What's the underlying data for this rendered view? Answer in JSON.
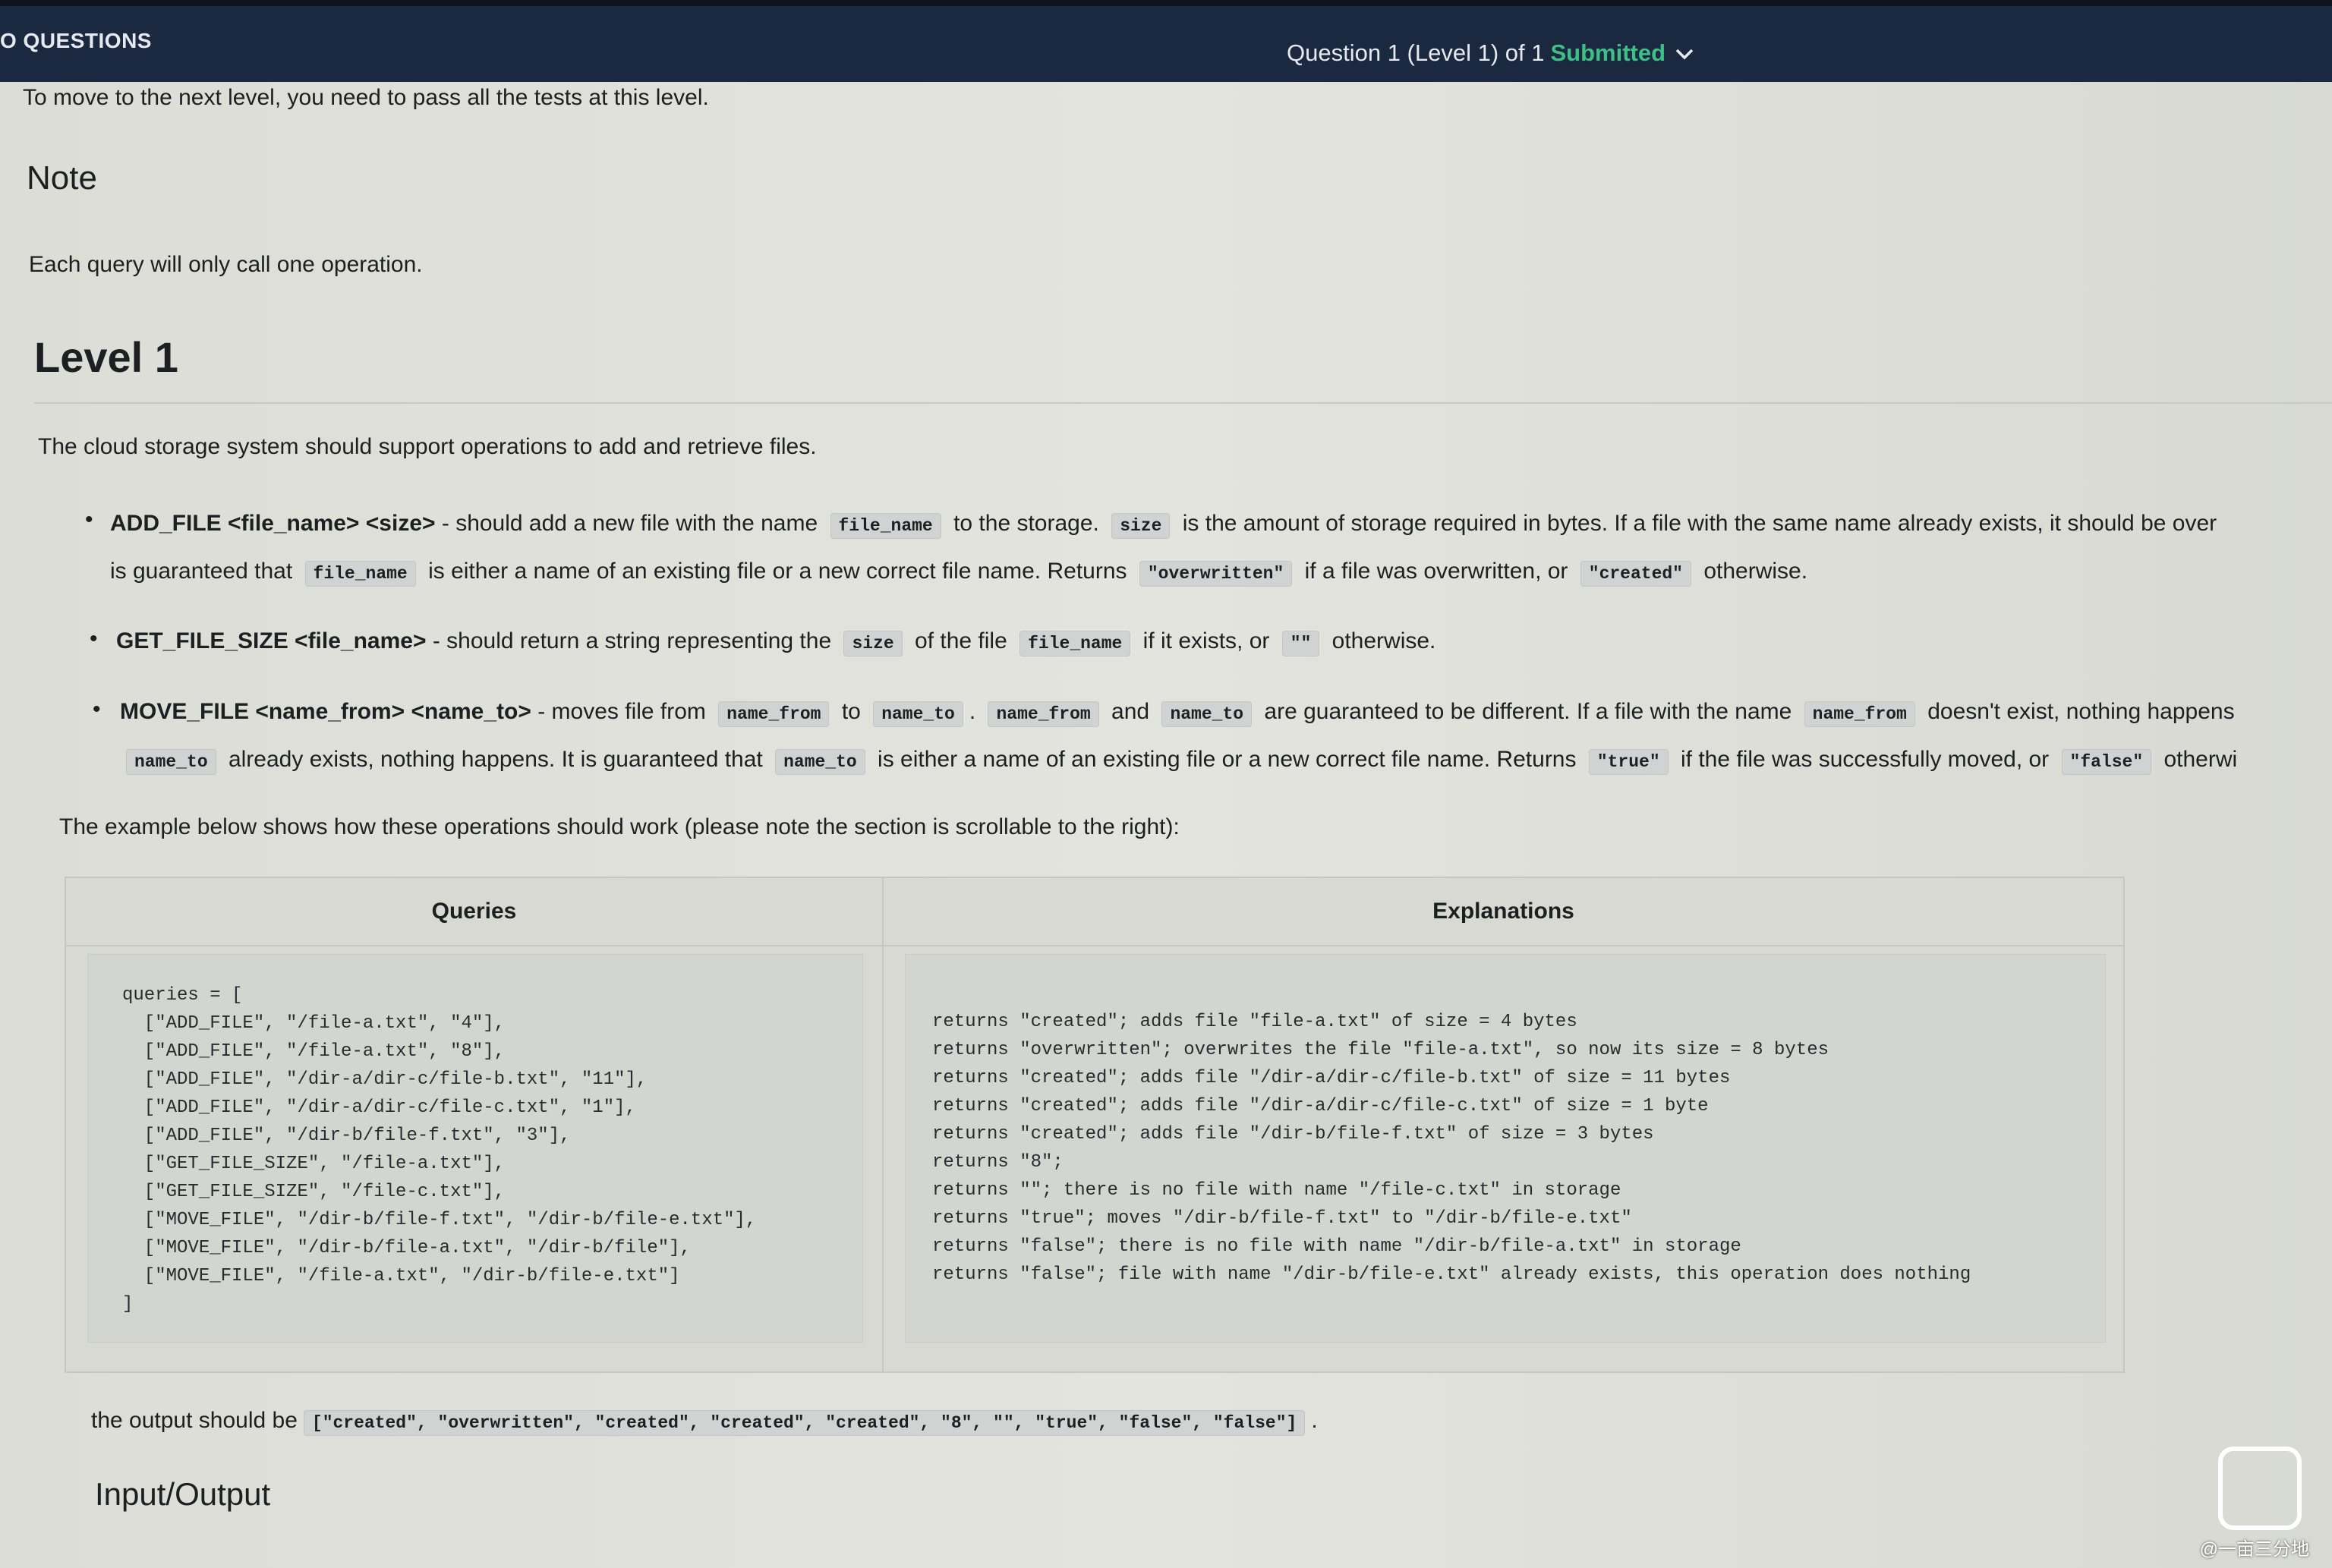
{
  "header": {
    "back_label": "O QUESTIONS",
    "question_title": "Question 1 (Level 1) of 1",
    "status": "Submitted",
    "status_color": "#3fbf85",
    "chevron_icon": "chevron-down-icon"
  },
  "intro": "To move to the next level, you need to pass all the tests at this level.",
  "note": {
    "heading": "Note",
    "text": "Each query will only call one operation."
  },
  "level": {
    "heading": "Level 1",
    "description": "The cloud storage system should support operations to add and retrieve files.",
    "bullets": [
      [
        [
          {
            "b": "ADD_FILE <file_name> <size>"
          },
          {
            "t": " - should add a new file with the name "
          },
          {
            "c": "file_name"
          },
          {
            "t": " to the storage. "
          },
          {
            "c": "size"
          },
          {
            "t": " is the amount of storage required in bytes. If a file with the same name already exists, it should be over"
          }
        ],
        [
          {
            "t": "is guaranteed that "
          },
          {
            "c": "file_name"
          },
          {
            "t": " is either a name of an existing file or a new correct file name. Returns "
          },
          {
            "c": "\"overwritten\""
          },
          {
            "t": " if a file was overwritten, or "
          },
          {
            "c": "\"created\""
          },
          {
            "t": " otherwise."
          }
        ]
      ],
      [
        [
          {
            "b": "GET_FILE_SIZE <file_name>"
          },
          {
            "t": " - should return a string representing the "
          },
          {
            "c": "size"
          },
          {
            "t": " of the file "
          },
          {
            "c": "file_name"
          },
          {
            "t": " if it exists, or "
          },
          {
            "c": "\"\""
          },
          {
            "t": " otherwise."
          }
        ]
      ],
      [
        [
          {
            "b": "MOVE_FILE <name_from> <name_to>"
          },
          {
            "t": " - moves file from "
          },
          {
            "c": "name_from"
          },
          {
            "t": " to "
          },
          {
            "c": "name_to"
          },
          {
            "t": ". "
          },
          {
            "c": "name_from"
          },
          {
            "t": " and "
          },
          {
            "c": "name_to"
          },
          {
            "t": " are guaranteed to be different. If a file with the name "
          },
          {
            "c": "name_from"
          },
          {
            "t": " doesn't exist, nothing happens"
          }
        ],
        [
          {
            "c": "name_to"
          },
          {
            "t": " already exists, nothing happens. It is guaranteed that "
          },
          {
            "c": "name_to"
          },
          {
            "t": " is either a name of an existing file or a new correct file name. Returns "
          },
          {
            "c": "\"true\""
          },
          {
            "t": " if the file was successfully moved, or "
          },
          {
            "c": "\"false\""
          },
          {
            "t": " otherwi"
          }
        ]
      ]
    ],
    "example_intro": "The example below shows how these operations should work (please note the section is scrollable to the right):"
  },
  "example_table": {
    "headers": [
      "Queries",
      "Explanations"
    ],
    "queries": "queries = [\n  [\"ADD_FILE\", \"/file-a.txt\", \"4\"],\n  [\"ADD_FILE\", \"/file-a.txt\", \"8\"],\n  [\"ADD_FILE\", \"/dir-a/dir-c/file-b.txt\", \"11\"],\n  [\"ADD_FILE\", \"/dir-a/dir-c/file-c.txt\", \"1\"],\n  [\"ADD_FILE\", \"/dir-b/file-f.txt\", \"3\"],\n  [\"GET_FILE_SIZE\", \"/file-a.txt\"],\n  [\"GET_FILE_SIZE\", \"/file-c.txt\"],\n  [\"MOVE_FILE\", \"/dir-b/file-f.txt\", \"/dir-b/file-e.txt\"],\n  [\"MOVE_FILE\", \"/dir-b/file-a.txt\", \"/dir-b/file\"],\n  [\"MOVE_FILE\", \"/file-a.txt\", \"/dir-b/file-e.txt\"]\n]",
    "explanations": "returns \"created\"; adds file \"file-a.txt\" of size = 4 bytes\nreturns \"overwritten\"; overwrites the file \"file-a.txt\", so now its size = 8 bytes\nreturns \"created\"; adds file \"/dir-a/dir-c/file-b.txt\" of size = 11 bytes\nreturns \"created\"; adds file \"/dir-a/dir-c/file-c.txt\" of size = 1 byte\nreturns \"created\"; adds file \"/dir-b/file-f.txt\" of size = 3 bytes\nreturns \"8\";\nreturns \"\"; there is no file with name \"/file-c.txt\" in storage\nreturns \"true\"; moves \"/dir-b/file-f.txt\" to \"/dir-b/file-e.txt\"\nreturns \"false\"; there is no file with name \"/dir-b/file-a.txt\" in storage\nreturns \"false\"; file with name \"/dir-b/file-e.txt\" already exists, this operation does nothing"
  },
  "output": {
    "label": "the output should be",
    "value": "[\"created\", \"overwritten\", \"created\", \"created\", \"created\", \"8\", \"\", \"true\", \"false\", \"false\"]",
    "suffix": "."
  },
  "input_output_heading": "Input/Output",
  "watermark": "@一亩三分地"
}
